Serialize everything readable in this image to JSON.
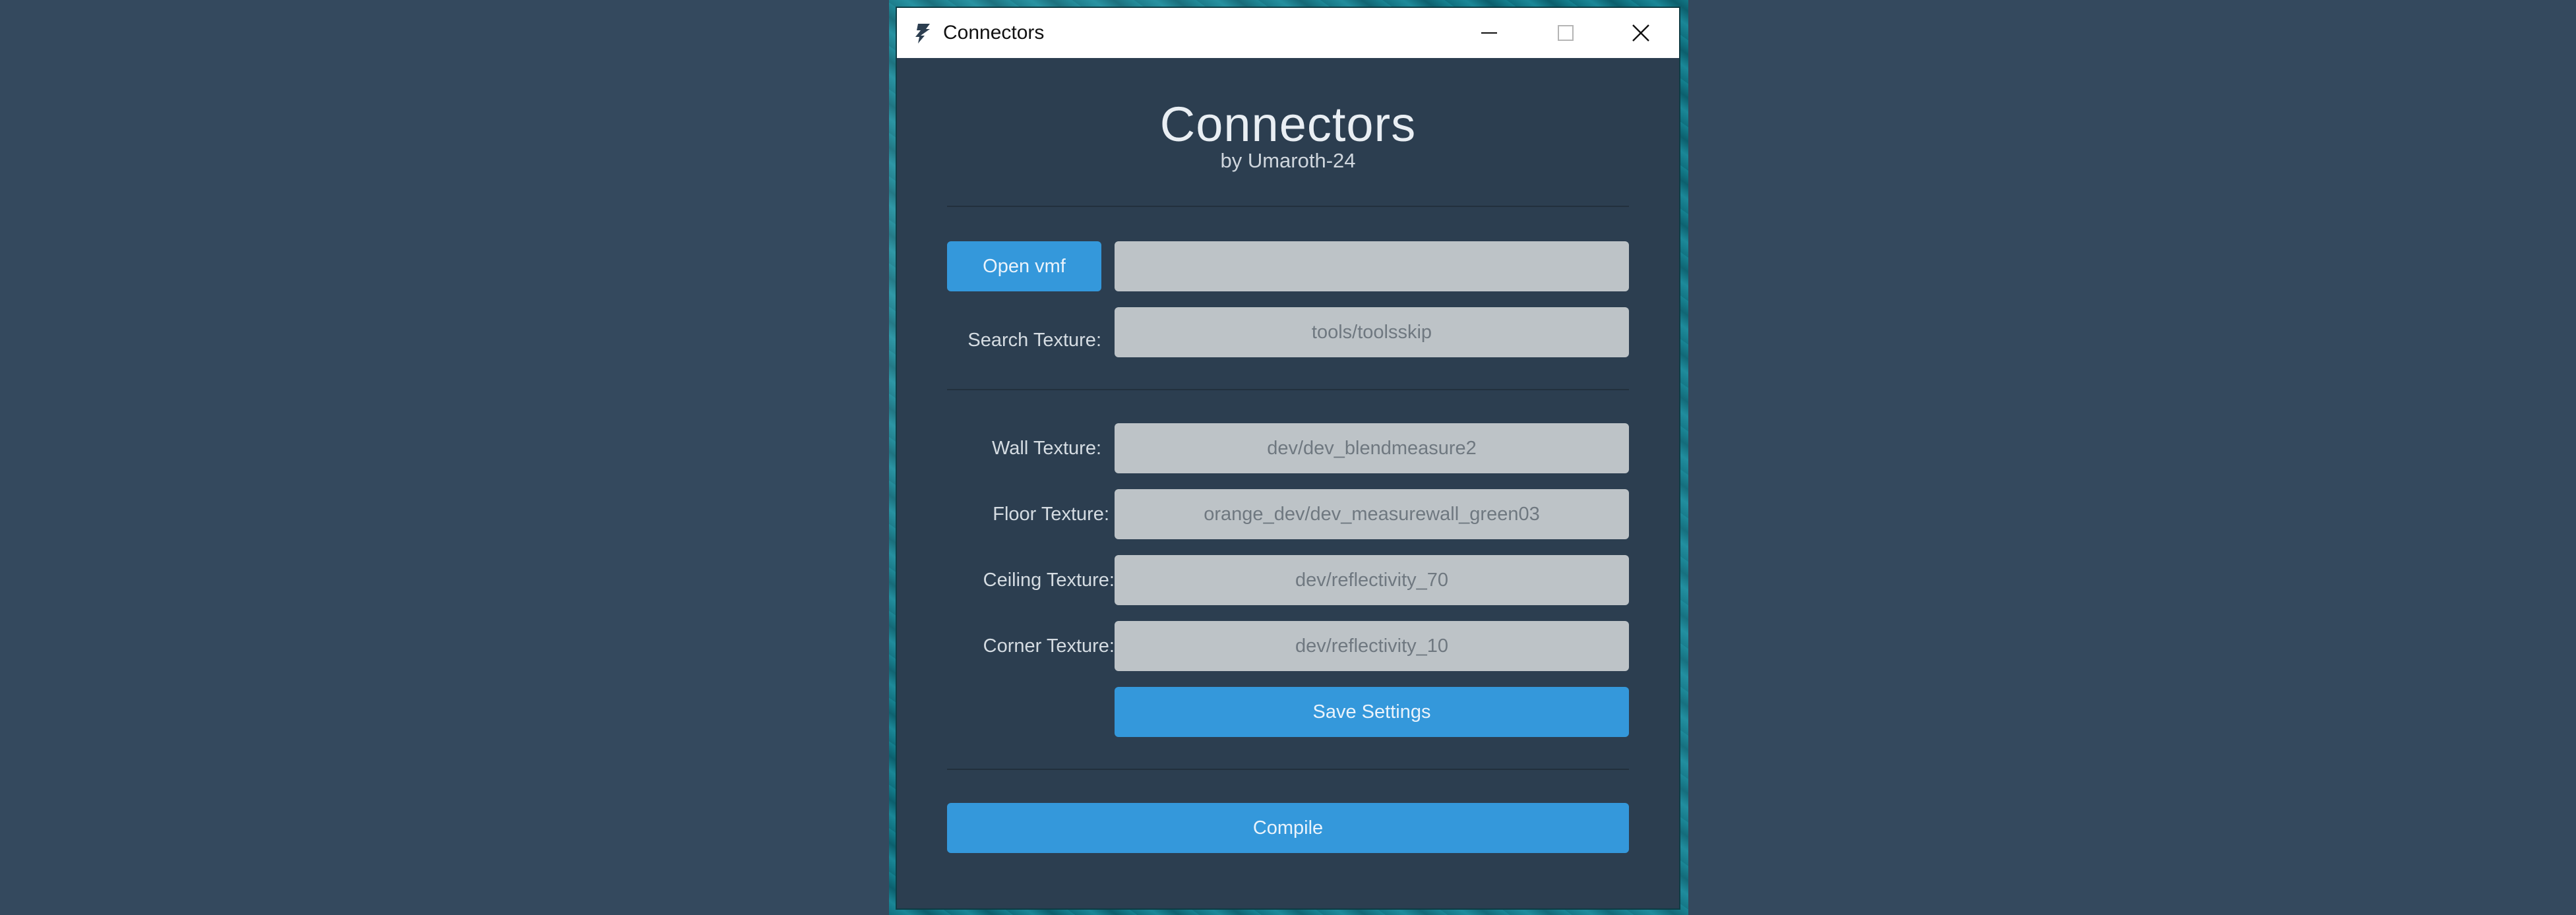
{
  "window": {
    "title": "Connectors"
  },
  "header": {
    "title": "Connectors",
    "subtitle": "by Umaroth-24"
  },
  "file": {
    "open_label": "Open vmf",
    "path_value": ""
  },
  "search": {
    "label": "Search Texture:",
    "value": "tools/toolsskip"
  },
  "textures": {
    "wall": {
      "label": "Wall Texture:",
      "value": "dev/dev_blendmeasure2"
    },
    "floor": {
      "label": "Floor Texture:",
      "value": "orange_dev/dev_measurewall_green03"
    },
    "ceiling": {
      "label": "Ceiling Texture:",
      "value": "dev/reflectivity_70"
    },
    "corner": {
      "label": "Corner Texture:",
      "value": "dev/reflectivity_10"
    }
  },
  "actions": {
    "save_label": "Save Settings",
    "compile_label": "Compile"
  },
  "colors": {
    "accent": "#3498db",
    "background": "#2c3e50",
    "field": "#bdc3c7",
    "desktop": "#34495e"
  },
  "icons": {
    "app": "connectors-logo-icon",
    "minimize": "minimize-icon",
    "maximize": "maximize-icon",
    "close": "close-icon"
  }
}
